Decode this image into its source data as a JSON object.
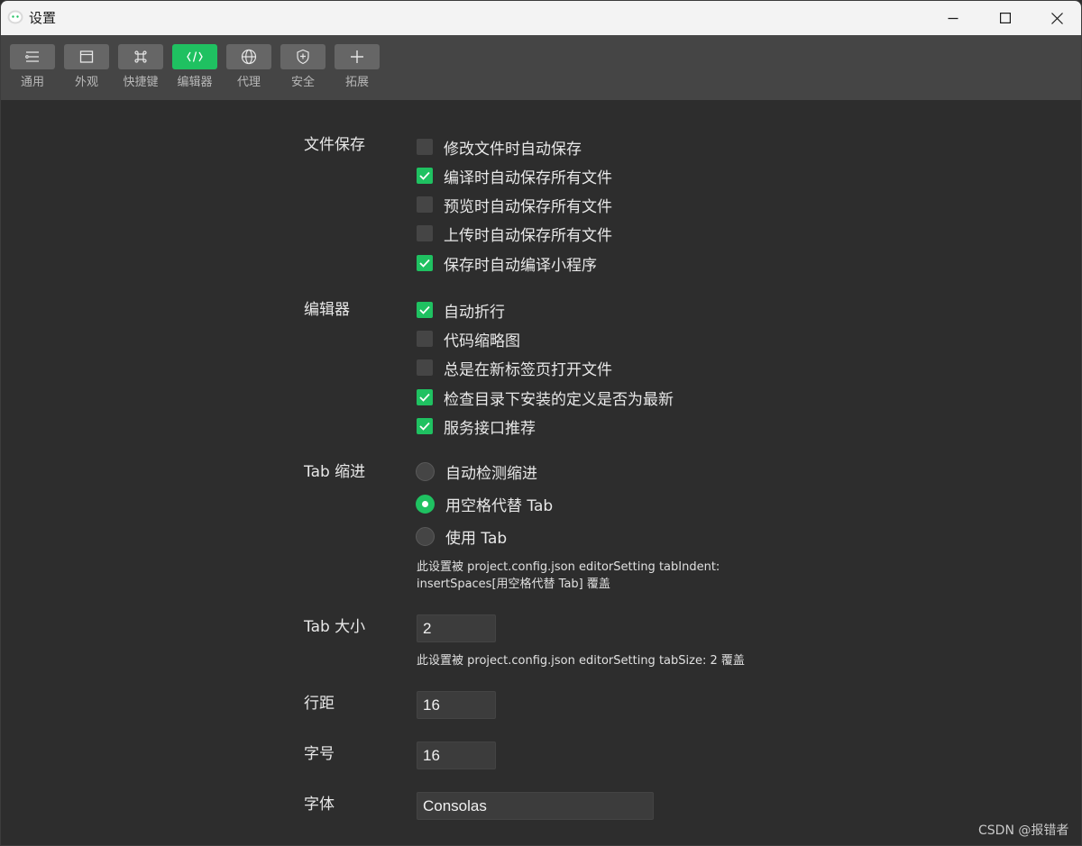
{
  "window": {
    "title": "设置",
    "controls": {
      "minimize": "minimize-icon",
      "maximize": "maximize-icon",
      "close": "close-icon"
    }
  },
  "colors": {
    "accent": "#1fc161",
    "toolbar_bg": "#454545",
    "content_bg": "#2d2d2d",
    "control_bg": "#454545"
  },
  "toolbar": {
    "tabs": [
      {
        "label": "通用",
        "icon": "general-settings-icon",
        "active": false
      },
      {
        "label": "外观",
        "icon": "appearance-window-icon",
        "active": false
      },
      {
        "label": "快捷键",
        "icon": "command-key-icon",
        "active": false
      },
      {
        "label": "编辑器",
        "icon": "code-editor-icon",
        "active": true
      },
      {
        "label": "代理",
        "icon": "globe-proxy-icon",
        "active": false
      },
      {
        "label": "安全",
        "icon": "shield-icon",
        "active": false
      },
      {
        "label": "拓展",
        "icon": "plus-icon",
        "active": false
      }
    ]
  },
  "file_save": {
    "label": "文件保存",
    "options": [
      {
        "label": "修改文件时自动保存",
        "checked": false
      },
      {
        "label": "编译时自动保存所有文件",
        "checked": true
      },
      {
        "label": "预览时自动保存所有文件",
        "checked": false
      },
      {
        "label": "上传时自动保存所有文件",
        "checked": false
      },
      {
        "label": "保存时自动编译小程序",
        "checked": true
      }
    ]
  },
  "editor": {
    "label": "编辑器",
    "options": [
      {
        "label": "自动折行",
        "checked": true
      },
      {
        "label": "代码缩略图",
        "checked": false
      },
      {
        "label": "总是在新标签页打开文件",
        "checked": false
      },
      {
        "label": "检查目录下安装的定义是否为最新",
        "checked": true
      },
      {
        "label": "服务接口推荐",
        "checked": true
      }
    ]
  },
  "tab_indent": {
    "label": "Tab 缩进",
    "options": [
      {
        "label": "自动检测缩进",
        "selected": false
      },
      {
        "label": "用空格代替 Tab",
        "selected": true
      },
      {
        "label": "使用 Tab",
        "selected": false
      }
    ],
    "note_line1": "此设置被 project.config.json editorSetting tabIndent:",
    "note_line2": "insertSpaces[用空格代替 Tab] 覆盖"
  },
  "tab_size": {
    "label": "Tab 大小",
    "value": "2",
    "note": "此设置被 project.config.json editorSetting tabSize: 2 覆盖"
  },
  "line_height": {
    "label": "行距",
    "value": "16"
  },
  "font_size": {
    "label": "字号",
    "value": "16"
  },
  "font_family": {
    "label": "字体",
    "value": "Consolas"
  },
  "watermark": "CSDN @报错者"
}
